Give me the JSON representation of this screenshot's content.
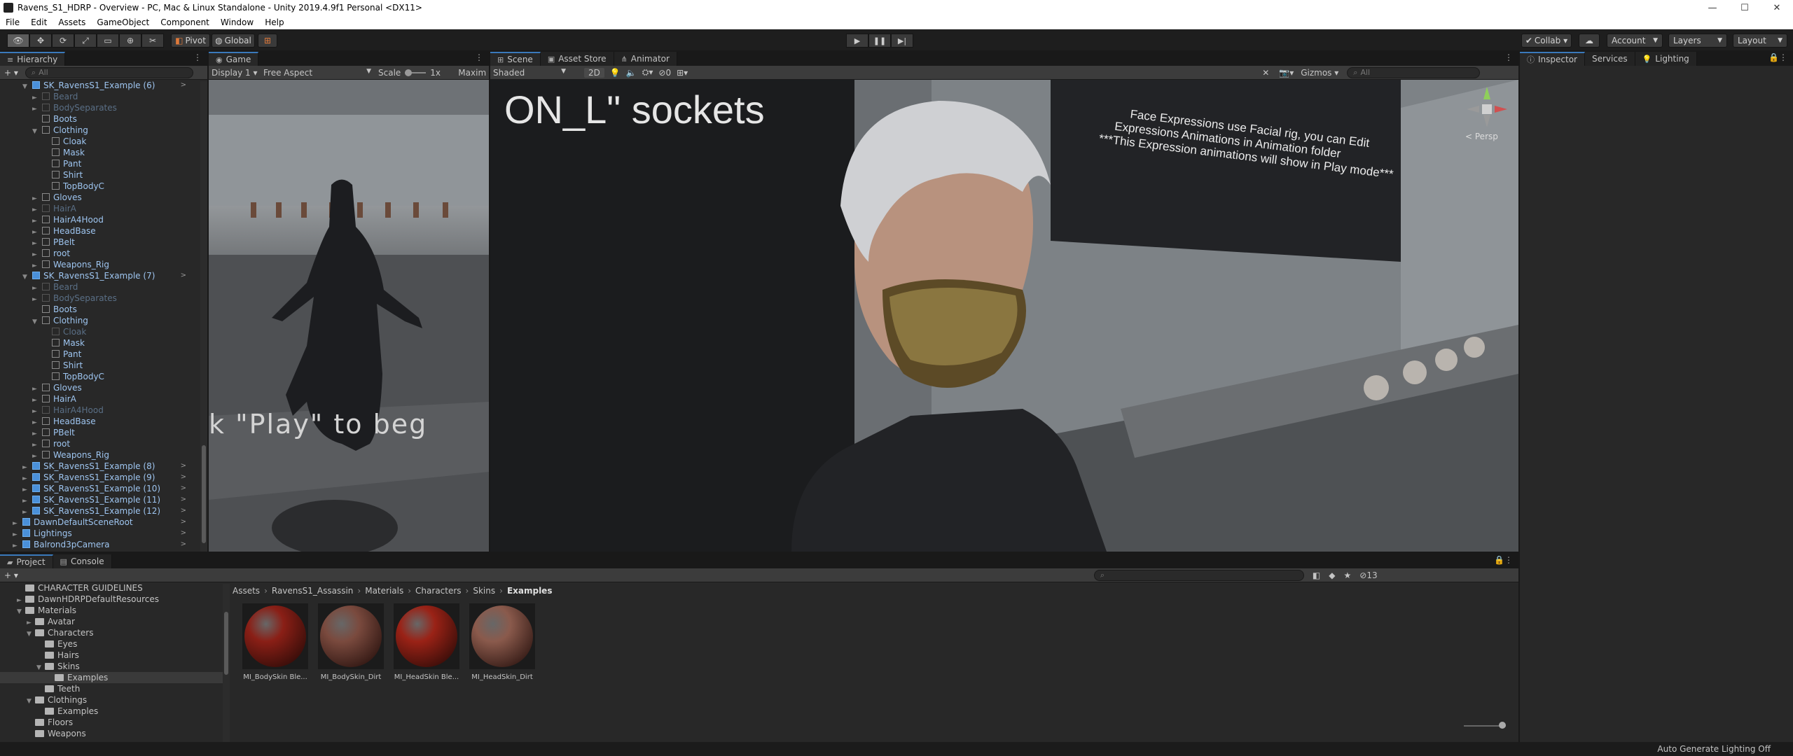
{
  "window": {
    "title": "Ravens_S1_HDRP - Overview - PC, Mac & Linux Standalone - Unity 2019.4.9f1 Personal <DX11>",
    "controls": [
      "—",
      "☐",
      "✕"
    ]
  },
  "menu": [
    "File",
    "Edit",
    "Assets",
    "GameObject",
    "Component",
    "Window",
    "Help"
  ],
  "toolbar": {
    "pivot": "Pivot",
    "global": "Global",
    "collab": "Collab ▾",
    "account": "Account",
    "layers": "Layers",
    "layout": "Layout"
  },
  "hierarchy": {
    "tab": "Hierarchy",
    "search_placeholder": "All",
    "rows": [
      {
        "indent": 3,
        "arrow": "▼",
        "type": "prefab",
        "name": "SK_RavensS1_Example (6)",
        "dim": false,
        "more": true
      },
      {
        "indent": 4,
        "arrow": "►",
        "type": "obj",
        "name": "Beard",
        "dim": true,
        "more": false
      },
      {
        "indent": 4,
        "arrow": "►",
        "type": "obj",
        "name": "BodySeparates",
        "dim": true,
        "more": false
      },
      {
        "indent": 4,
        "arrow": "",
        "type": "obj",
        "name": "Boots",
        "dim": false,
        "more": false
      },
      {
        "indent": 4,
        "arrow": "▼",
        "type": "obj",
        "name": "Clothing",
        "dim": false,
        "more": false
      },
      {
        "indent": 5,
        "arrow": "",
        "type": "obj",
        "name": "Cloak",
        "dim": false,
        "more": false
      },
      {
        "indent": 5,
        "arrow": "",
        "type": "obj",
        "name": "Mask",
        "dim": false,
        "more": false
      },
      {
        "indent": 5,
        "arrow": "",
        "type": "obj",
        "name": "Pant",
        "dim": false,
        "more": false
      },
      {
        "indent": 5,
        "arrow": "",
        "type": "obj",
        "name": "Shirt",
        "dim": false,
        "more": false
      },
      {
        "indent": 5,
        "arrow": "",
        "type": "obj",
        "name": "TopBodyC",
        "dim": false,
        "more": false
      },
      {
        "indent": 4,
        "arrow": "►",
        "type": "obj",
        "name": "Gloves",
        "dim": false,
        "more": false
      },
      {
        "indent": 4,
        "arrow": "►",
        "type": "obj",
        "name": "HairA",
        "dim": true,
        "more": false
      },
      {
        "indent": 4,
        "arrow": "►",
        "type": "obj",
        "name": "HairA4Hood",
        "dim": false,
        "more": false
      },
      {
        "indent": 4,
        "arrow": "►",
        "type": "obj",
        "name": "HeadBase",
        "dim": false,
        "more": false
      },
      {
        "indent": 4,
        "arrow": "►",
        "type": "obj",
        "name": "PBelt",
        "dim": false,
        "more": false
      },
      {
        "indent": 4,
        "arrow": "►",
        "type": "obj",
        "name": "root",
        "dim": false,
        "more": false
      },
      {
        "indent": 4,
        "arrow": "►",
        "type": "obj",
        "name": "Weapons_Rig",
        "dim": false,
        "more": false
      },
      {
        "indent": 3,
        "arrow": "▼",
        "type": "prefab",
        "name": "SK_RavensS1_Example (7)",
        "dim": false,
        "more": true
      },
      {
        "indent": 4,
        "arrow": "►",
        "type": "obj",
        "name": "Beard",
        "dim": true,
        "more": false
      },
      {
        "indent": 4,
        "arrow": "►",
        "type": "obj",
        "name": "BodySeparates",
        "dim": true,
        "more": false
      },
      {
        "indent": 4,
        "arrow": "",
        "type": "obj",
        "name": "Boots",
        "dim": false,
        "more": false
      },
      {
        "indent": 4,
        "arrow": "▼",
        "type": "obj",
        "name": "Clothing",
        "dim": false,
        "more": false
      },
      {
        "indent": 5,
        "arrow": "",
        "type": "obj",
        "name": "Cloak",
        "dim": true,
        "more": false
      },
      {
        "indent": 5,
        "arrow": "",
        "type": "obj",
        "name": "Mask",
        "dim": false,
        "more": false
      },
      {
        "indent": 5,
        "arrow": "",
        "type": "obj",
        "name": "Pant",
        "dim": false,
        "more": false
      },
      {
        "indent": 5,
        "arrow": "",
        "type": "obj",
        "name": "Shirt",
        "dim": false,
        "more": false
      },
      {
        "indent": 5,
        "arrow": "",
        "type": "obj",
        "name": "TopBodyC",
        "dim": false,
        "more": false
      },
      {
        "indent": 4,
        "arrow": "►",
        "type": "obj",
        "name": "Gloves",
        "dim": false,
        "more": false
      },
      {
        "indent": 4,
        "arrow": "►",
        "type": "obj",
        "name": "HairA",
        "dim": false,
        "more": false
      },
      {
        "indent": 4,
        "arrow": "►",
        "type": "obj",
        "name": "HairA4Hood",
        "dim": true,
        "more": false
      },
      {
        "indent": 4,
        "arrow": "►",
        "type": "obj",
        "name": "HeadBase",
        "dim": false,
        "more": false
      },
      {
        "indent": 4,
        "arrow": "►",
        "type": "obj",
        "name": "PBelt",
        "dim": false,
        "more": false
      },
      {
        "indent": 4,
        "arrow": "►",
        "type": "obj",
        "name": "root",
        "dim": false,
        "more": false
      },
      {
        "indent": 4,
        "arrow": "►",
        "type": "obj",
        "name": "Weapons_Rig",
        "dim": false,
        "more": false
      },
      {
        "indent": 3,
        "arrow": "►",
        "type": "prefab",
        "name": "SK_RavensS1_Example (8)",
        "dim": false,
        "more": true
      },
      {
        "indent": 3,
        "arrow": "►",
        "type": "prefab",
        "name": "SK_RavensS1_Example (9)",
        "dim": false,
        "more": true
      },
      {
        "indent": 3,
        "arrow": "►",
        "type": "prefab",
        "name": "SK_RavensS1_Example (10)",
        "dim": false,
        "more": true
      },
      {
        "indent": 3,
        "arrow": "►",
        "type": "prefab",
        "name": "SK_RavensS1_Example (11)",
        "dim": false,
        "more": true
      },
      {
        "indent": 3,
        "arrow": "►",
        "type": "prefab",
        "name": "SK_RavensS1_Example (12)",
        "dim": false,
        "more": true
      },
      {
        "indent": 2,
        "arrow": "►",
        "type": "prefab",
        "name": "DawnDefaultSceneRoot",
        "dim": false,
        "more": true
      },
      {
        "indent": 2,
        "arrow": "►",
        "type": "prefab",
        "name": "Lightings",
        "dim": false,
        "more": true
      },
      {
        "indent": 2,
        "arrow": "►",
        "type": "prefab",
        "name": "Balrond3pCamera",
        "dim": false,
        "more": true
      }
    ]
  },
  "game": {
    "tab": "Game",
    "display": "Display 1",
    "aspect": "Free Aspect",
    "scale_label": "Scale",
    "scale_value": "1x",
    "maximize": "Maxim",
    "overlay_text": "k \"Play\" to beg"
  },
  "scene": {
    "tabs": [
      "Scene",
      "Asset Store",
      "Animator"
    ],
    "shading": "Shaded",
    "mode_2d": "2D",
    "fx_count": "0",
    "gizmos": "Gizmos",
    "search_placeholder": "All",
    "persp": "Persp",
    "sign_text_top": "ON_L\" sockets",
    "sign_lines": [
      "Face Expressions use Facial rig, you can Edit",
      "Expressions Animations in Animation folder",
      "***This Expression animations will show in Play mode***"
    ]
  },
  "inspector": {
    "tabs": [
      "Inspector",
      "Services",
      "Lighting"
    ]
  },
  "project": {
    "tabs": [
      "Project",
      "Console"
    ],
    "badge_count": "13",
    "tree": [
      {
        "indent": 1,
        "arrow": "",
        "name": "CHARACTER GUIDELINES",
        "sel": false
      },
      {
        "indent": 1,
        "arrow": "►",
        "name": "DawnHDRPDefaultResources",
        "sel": false
      },
      {
        "indent": 1,
        "arrow": "▼",
        "name": "Materials",
        "sel": false
      },
      {
        "indent": 2,
        "arrow": "►",
        "name": "Avatar",
        "sel": false
      },
      {
        "indent": 2,
        "arrow": "▼",
        "name": "Characters",
        "sel": false
      },
      {
        "indent": 3,
        "arrow": "",
        "name": "Eyes",
        "sel": false
      },
      {
        "indent": 3,
        "arrow": "",
        "name": "Hairs",
        "sel": false
      },
      {
        "indent": 3,
        "arrow": "▼",
        "name": "Skins",
        "sel": false
      },
      {
        "indent": 4,
        "arrow": "",
        "name": "Examples",
        "sel": true
      },
      {
        "indent": 3,
        "arrow": "",
        "name": "Teeth",
        "sel": false
      },
      {
        "indent": 2,
        "arrow": "▼",
        "name": "Clothings",
        "sel": false
      },
      {
        "indent": 3,
        "arrow": "",
        "name": "Examples",
        "sel": false
      },
      {
        "indent": 2,
        "arrow": "",
        "name": "Floors",
        "sel": false
      },
      {
        "indent": 2,
        "arrow": "",
        "name": "Weapons",
        "sel": false
      }
    ],
    "breadcrumb": [
      "Assets",
      "RavensS1_Assassin",
      "Materials",
      "Characters",
      "Skins",
      "Examples"
    ],
    "assets": [
      {
        "label": "MI_BodySkin Ble...",
        "color": "#8a1f16"
      },
      {
        "label": "MI_BodySkin_Dirt",
        "color": "#7a4a3e"
      },
      {
        "label": "MI_HeadSkin Ble...",
        "color": "#9a2216"
      },
      {
        "label": "MI_HeadSkin_Dirt",
        "color": "#8a5a4c"
      }
    ]
  },
  "status": {
    "text": "Auto Generate Lighting Off"
  }
}
